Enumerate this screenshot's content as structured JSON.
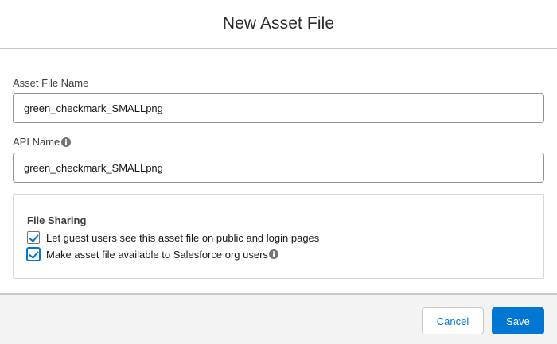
{
  "header": {
    "title": "New Asset File"
  },
  "form": {
    "asset_file_name": {
      "label": "Asset File Name",
      "value": "green_checkmark_SMALLpng"
    },
    "api_name": {
      "label": "API Name",
      "value": "green_checkmark_SMALLpng",
      "icon": "info-icon"
    }
  },
  "file_sharing": {
    "title": "File Sharing",
    "options": [
      {
        "label": "Let guest users see this asset file on public and login pages",
        "checked": true
      },
      {
        "label": "Make asset file available to Salesforce org users",
        "checked": true,
        "icon": "info-icon"
      }
    ]
  },
  "footer": {
    "cancel_label": "Cancel",
    "save_label": "Save"
  },
  "colors": {
    "brand": "#0176d3",
    "footer_bg": "#f3f3f3",
    "border": "#c9c9c9"
  }
}
